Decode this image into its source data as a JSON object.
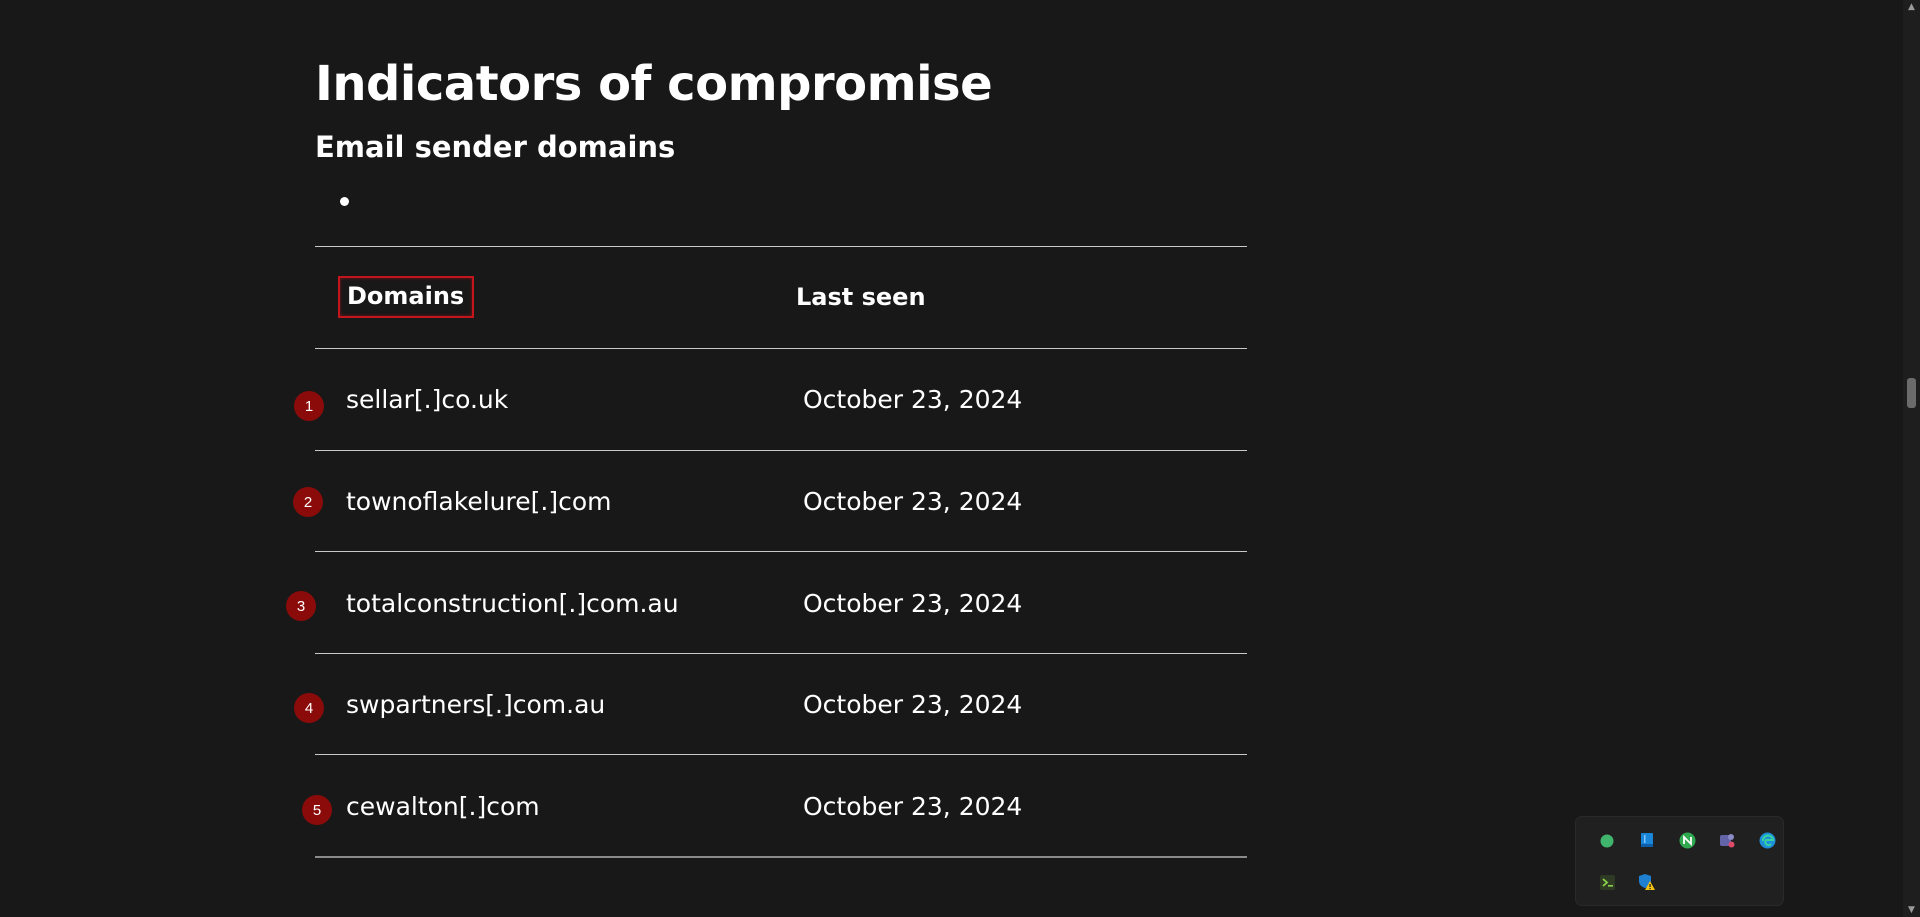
{
  "heading": "Indicators of compromise",
  "subheading": "Email sender domains",
  "table": {
    "headers": {
      "domains": "Domains",
      "last_seen": "Last seen"
    },
    "rows": [
      {
        "marker": "1",
        "domain": "sellar[.]co.uk",
        "last_seen": "October 23, 2024"
      },
      {
        "marker": "2",
        "domain": "townoflakelure[.]com",
        "last_seen": "October 23, 2024"
      },
      {
        "marker": "3",
        "domain": "totalconstruction[.]com.au",
        "last_seen": "October 23, 2024"
      },
      {
        "marker": "4",
        "domain": "swpartners[.]com.au",
        "last_seen": "October 23, 2024"
      },
      {
        "marker": "5",
        "domain": "cewalton[.]com",
        "last_seen": "October 23, 2024"
      }
    ]
  },
  "colors": {
    "background": "#181818",
    "marker": "#8b0b0b",
    "highlight_border": "#c3151c"
  },
  "tray_icons": [
    "green-dot-icon",
    "blue-book-icon",
    "green-n-icon",
    "purple-app-icon",
    "edge-icon",
    "green-terminal-icon",
    "defender-warning-icon"
  ]
}
